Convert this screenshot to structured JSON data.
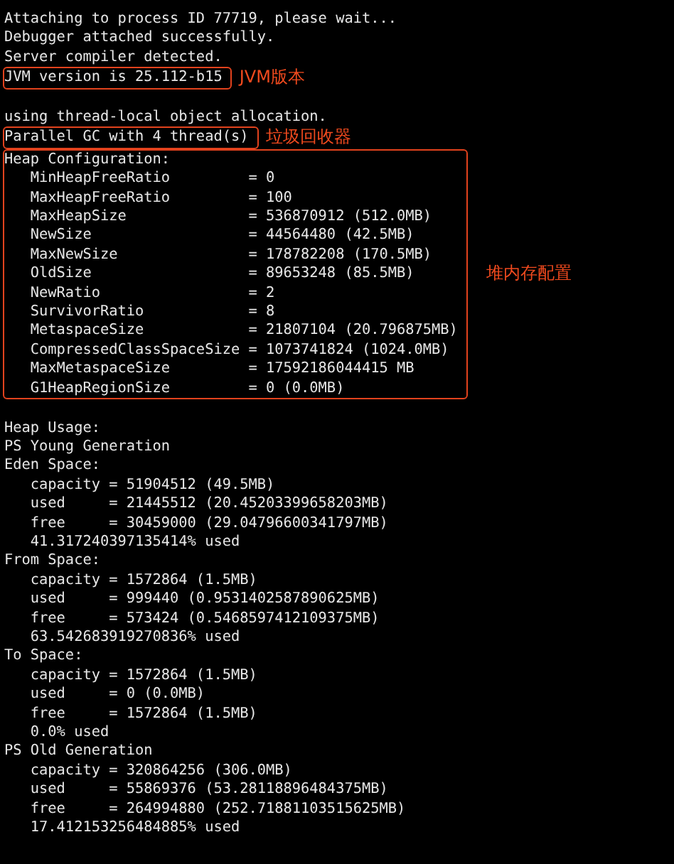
{
  "terminal": {
    "blocks": [
      {
        "kind": "plain",
        "gap_before": false,
        "lines": [
          "Attaching to process ID 77719, please wait...",
          "Debugger attached successfully.",
          "Server compiler detected."
        ]
      },
      {
        "kind": "marked",
        "gap_before": false,
        "note": "JVM版本",
        "lines": [
          "JVM version is 25.112-b15"
        ]
      },
      {
        "kind": "plain",
        "gap_before": true,
        "lines": [
          "using thread-local object allocation."
        ]
      },
      {
        "kind": "marked",
        "gap_before": false,
        "note": "垃圾回收器",
        "lines": [
          "Parallel GC with 4 thread(s)"
        ]
      },
      {
        "kind": "marked",
        "gap_before": false,
        "note": "堆内存配置",
        "lines": [
          "Heap Configuration:",
          "   MinHeapFreeRatio         = 0",
          "   MaxHeapFreeRatio         = 100",
          "   MaxHeapSize              = 536870912 (512.0MB)",
          "   NewSize                  = 44564480 (42.5MB)",
          "   MaxNewSize               = 178782208 (170.5MB)",
          "   OldSize                  = 89653248 (85.5MB)",
          "   NewRatio                 = 2",
          "   SurvivorRatio            = 8",
          "   MetaspaceSize            = 21807104 (20.796875MB)",
          "   CompressedClassSpaceSize = 1073741824 (1024.0MB)",
          "   MaxMetaspaceSize         = 17592186044415 MB",
          "   G1HeapRegionSize         = 0 (0.0MB)"
        ]
      },
      {
        "kind": "plain",
        "gap_before": true,
        "lines": [
          "Heap Usage:",
          "PS Young Generation",
          "Eden Space:",
          "   capacity = 51904512 (49.5MB)",
          "   used     = 21445512 (20.45203399658203MB)",
          "   free     = 30459000 (29.04796600341797MB)",
          "   41.317240397135414% used",
          "From Space:",
          "   capacity = 1572864 (1.5MB)",
          "   used     = 999440 (0.9531402587890625MB)",
          "   free     = 573424 (0.5468597412109375MB)",
          "   63.542683919270836% used",
          "To Space:",
          "   capacity = 1572864 (1.5MB)",
          "   used     = 0 (0.0MB)",
          "   free     = 1572864 (1.5MB)",
          "   0.0% used",
          "PS Old Generation",
          "   capacity = 320864256 (306.0MB)",
          "   used     = 55869376 (53.28118896484375MB)",
          "   free     = 264994880 (252.71881103515625MB)",
          "   17.412153256484885% used"
        ]
      }
    ]
  }
}
